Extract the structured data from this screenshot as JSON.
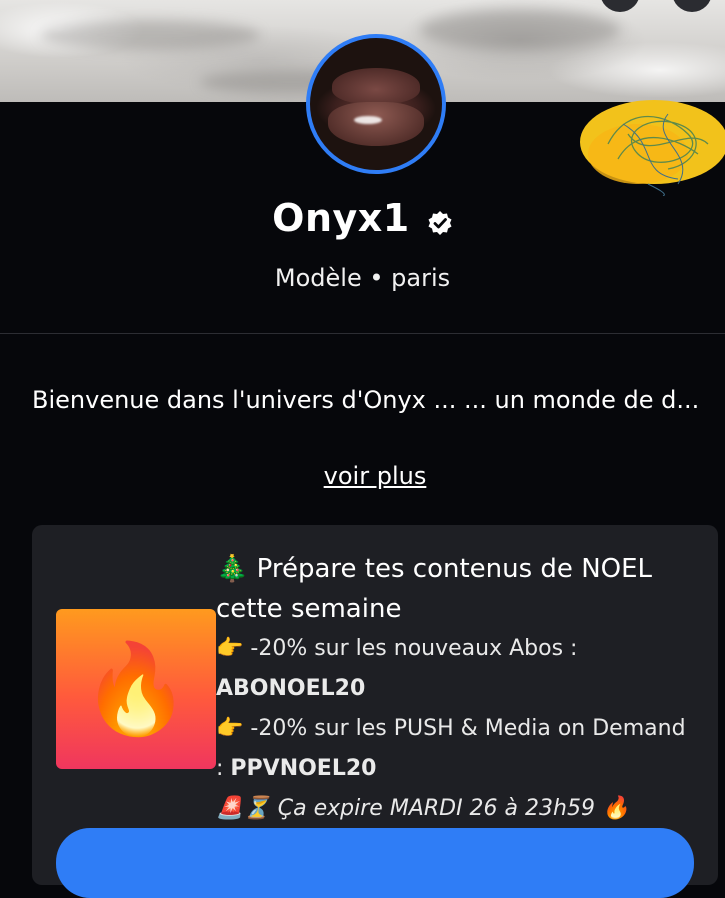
{
  "profile": {
    "name": "Onyx1",
    "subtitle": "Modèle • paris",
    "bio": "Bienvenue dans l'univers d'Onyx ... ... un monde de d...",
    "more_link": "voir plus"
  },
  "post": {
    "headline": "🎄 Prépare tes contenus de NOEL cette semaine",
    "line1_prefix": "👉 -20% sur les nouveaux Abos :",
    "line1_code": "ABONOEL20",
    "line2_prefix": "👉 -20% sur les PUSH & Media on Demand :",
    "line2_code": "PPVNOEL20",
    "expiry": "🚨⏳ Ça expire MARDI 26 à 23h59 🔥",
    "thumbnail_icon": "🔥"
  },
  "colors": {
    "accent": "#2f7df6",
    "background": "#06070b",
    "card": "#1e1f24"
  },
  "icons": {
    "verified": "verified-badge-icon",
    "thumbnail": "fire-icon"
  }
}
